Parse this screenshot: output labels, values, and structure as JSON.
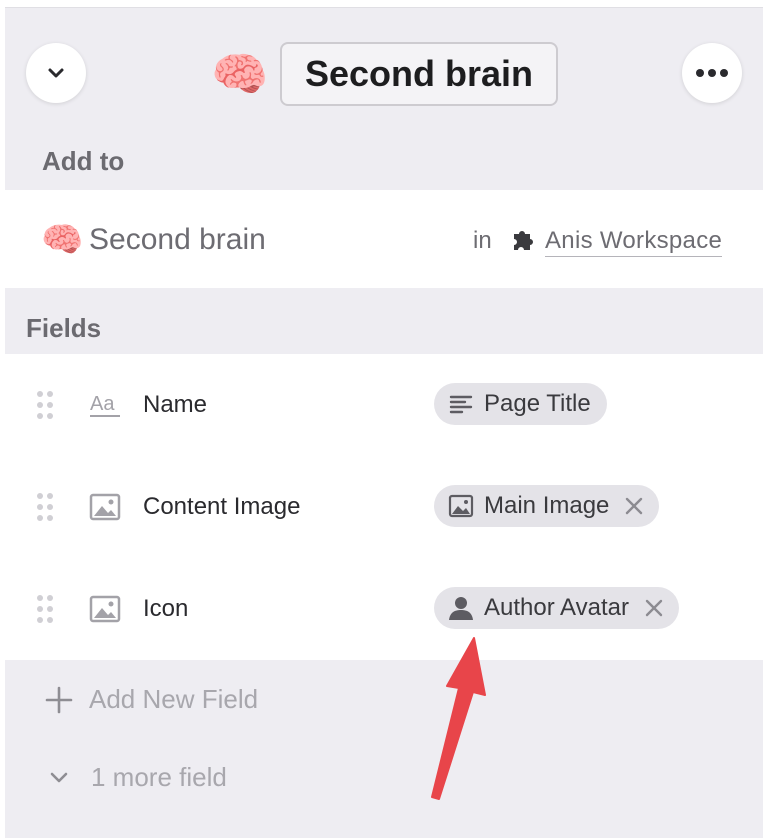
{
  "header": {
    "title": "Second brain",
    "emoji": "🧠",
    "collapse_icon": "chevron-down-icon",
    "more_icon": "more-horizontal-icon"
  },
  "add_to": {
    "label": "Add to",
    "database": {
      "emoji": "🧠",
      "name": "Second brain"
    },
    "in_label": "in",
    "workspace": {
      "icon": "puzzle-icon",
      "name": "Anis Workspace"
    }
  },
  "fields": {
    "label": "Fields",
    "items": [
      {
        "type_icon": "text-type-icon",
        "name": "Name",
        "mapping": {
          "icon": "lines-icon",
          "label": "Page Title",
          "removable": false
        }
      },
      {
        "type_icon": "image-icon",
        "name": "Content Image",
        "mapping": {
          "icon": "image-icon",
          "label": "Main Image",
          "removable": true
        }
      },
      {
        "type_icon": "image-icon",
        "name": "Icon",
        "mapping": {
          "icon": "person-icon",
          "label": "Author Avatar",
          "removable": true
        }
      }
    ]
  },
  "add_new_field": {
    "label": "Add New Field",
    "icon": "plus-icon"
  },
  "more_fields": {
    "label": "1 more field",
    "icon": "chevron-down-icon"
  },
  "annotation": {
    "type": "arrow",
    "color": "#e8454a"
  }
}
